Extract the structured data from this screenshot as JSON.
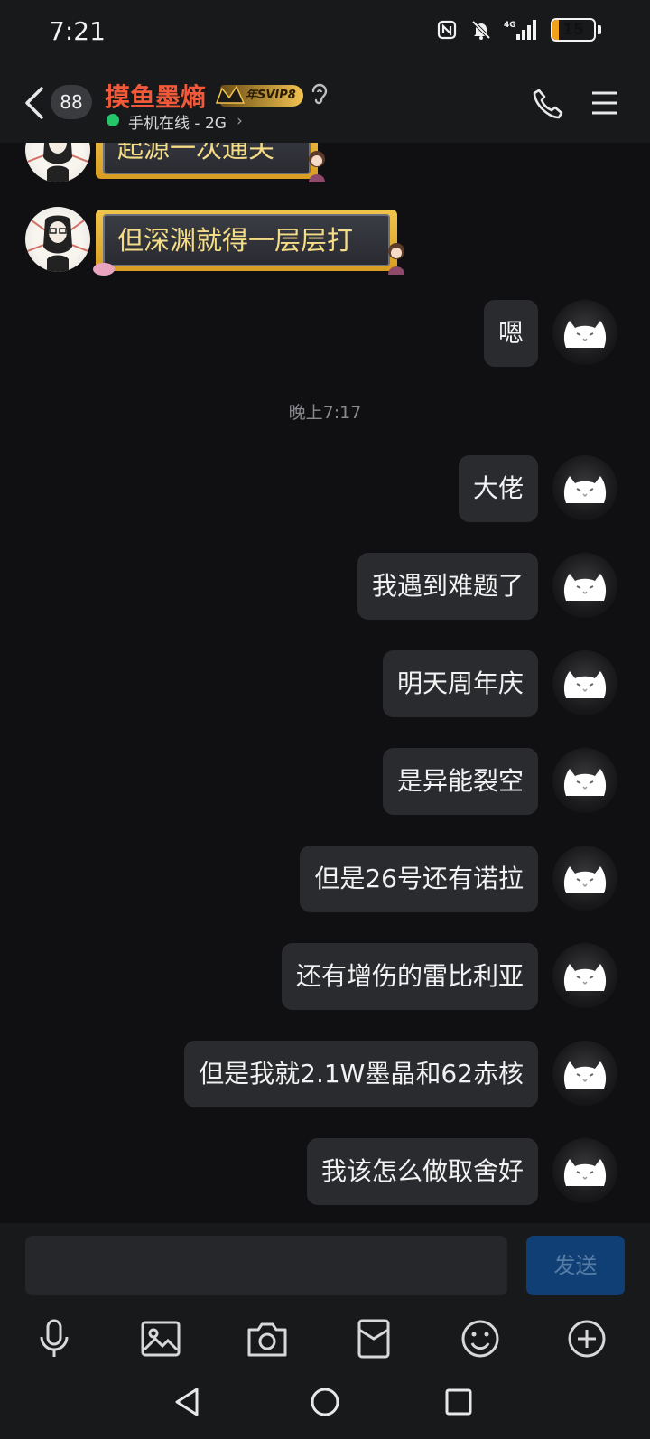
{
  "status_bar": {
    "time": "7:21",
    "battery": "15",
    "battery_level": 0.15,
    "network": "4G"
  },
  "header": {
    "unread_count": "88",
    "contact_name": "摸鱼墨熵",
    "vip_label": "年SVIP8",
    "online_status": "手机在线 - 2G",
    "chevron": "›"
  },
  "messages": {
    "incoming": [
      {
        "text": "起源一次通关"
      },
      {
        "text": "但深渊就得一层层打"
      }
    ],
    "outgoing_before": [
      {
        "text": "嗯"
      }
    ],
    "timestamp": "晚上7:17",
    "outgoing": [
      {
        "text": "大佬"
      },
      {
        "text": "我遇到难题了"
      },
      {
        "text": "明天周年庆"
      },
      {
        "text": "是异能裂空"
      },
      {
        "text": "但是26号还有诺拉"
      },
      {
        "text": "还有增伤的雷比利亚"
      },
      {
        "text": "但是我就2.1W墨晶和62赤核"
      },
      {
        "text": "我该怎么做取舍好"
      }
    ]
  },
  "input": {
    "placeholder": "",
    "send_label": "发送"
  },
  "toolbar": {
    "icons": [
      "microphone-icon",
      "image-icon",
      "camera-icon",
      "red-packet-icon",
      "emoji-icon",
      "plus-icon"
    ]
  },
  "nav": {
    "icons": [
      "back-triangle-icon",
      "home-circle-icon",
      "recent-square-icon"
    ]
  },
  "colors": {
    "name": "#f05a3a",
    "online": "#25c56a",
    "send_bg": "#0f3f75",
    "bubble": "#2a2b2f",
    "battery": "#f2a11b"
  }
}
